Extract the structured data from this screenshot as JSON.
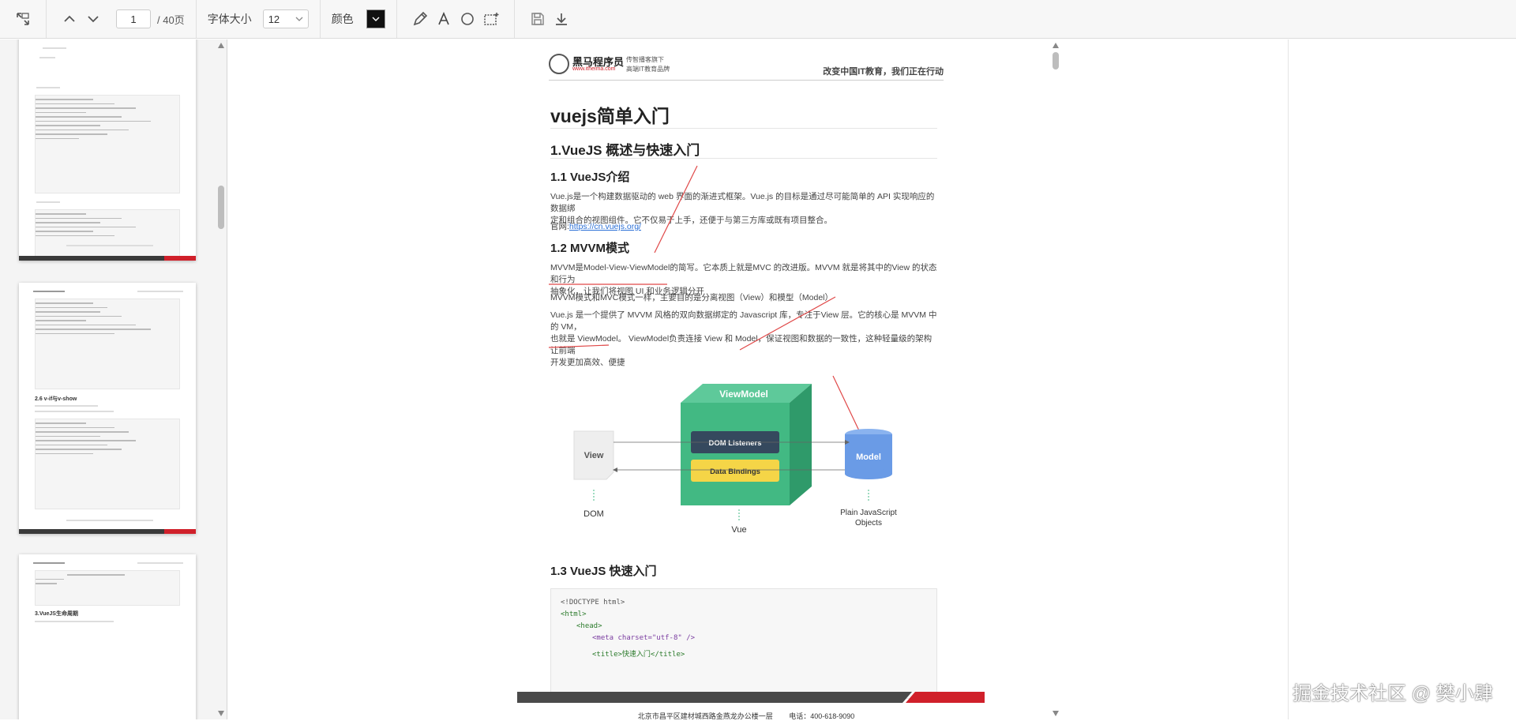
{
  "toolbar": {
    "page_current": "1",
    "page_total": "/ 40页",
    "font_size_label": "字体大小",
    "font_size_value": "12",
    "color_label": "颜色",
    "colors": {
      "swatch": "#111111"
    },
    "icons": [
      "fit-width-icon",
      "prev-page-icon",
      "next-page-icon",
      "pencil-icon",
      "text-icon",
      "circle-icon",
      "rectangle-select-icon",
      "save-icon",
      "download-icon"
    ]
  },
  "document": {
    "header": {
      "logo_name": "黑马程序员",
      "logo_url": "www.itheima.com",
      "logo_sub1": "传智播客旗下",
      "logo_sub2": "高端IT教育品牌",
      "slogan": "改变中国IT教育，我们正在行动"
    },
    "title": "vuejs简单入门",
    "section1": "1.VueJS 概述与快速入门",
    "s11": {
      "heading": "1.1 VueJS介绍",
      "p1_line1": "Vue.js是一个构建数据驱动的 web 界面的渐进式框架。Vue.js 的目标是通过尽可能简单的 API 实现响应的数据绑",
      "p1_line2": "定和组合的视图组件。它不仅易于上手，还便于与第三方库或既有项目整合。",
      "site_label": "官网:",
      "site_url": "https://cn.vuejs.org/"
    },
    "s12": {
      "heading": "1.2 MVVM模式",
      "p1_line1": "MVVM是Model-View-ViewModel的简写。它本质上就是MVC 的改进版。MVVM 就是将其中的View 的状态和行为",
      "p1_line2": "抽象化，让我们将视图 UI 和业务逻辑分开",
      "p2": "MVVM模式和MVC模式一样，主要目的是分离视图（View）和模型（Model）",
      "p3_line1": "Vue.js 是一个提供了 MVVM 风格的双向数据绑定的 Javascript 库，专注于View 层。它的核心是 MVVM 中的 VM，",
      "p3_line2": "也就是 ViewModel。 ViewModel负责连接 View 和 Model，保证视图和数据的一致性，这种轻量级的架构让前端",
      "p3_line3": "开发更加高效、便捷"
    },
    "diagram": {
      "viewmodel": "ViewModel",
      "dom_listeners": "DOM Listeners",
      "data_bindings": "Data Bindings",
      "view": "View",
      "model": "Model",
      "dom": "DOM",
      "vue": "Vue",
      "plain_js_line1": "Plain JavaScript",
      "plain_js_line2": "Objects",
      "colors": {
        "cube_front": "#42b983",
        "cube_top": "#5ec99a",
        "cube_side": "#2f9a6a",
        "listeners": "#35495e",
        "bindings": "#f5d547",
        "model": "#6a9be6"
      }
    },
    "s13": {
      "heading": "1.3 VueJS 快速入门",
      "code": [
        "<!DOCTYPE html>",
        "<html>",
        "<head>",
        "<meta charset=\"utf-8\" />",
        "<title>快速入门</title>"
      ]
    },
    "footer": {
      "address": "北京市昌平区建材城西路金燕龙办公楼一层",
      "phone": "电话：400-618-9090"
    }
  },
  "sidebar": {
    "thumb2_heading": "2.6 v-if与v-show",
    "thumb3_heading": "3.VueJS生命周期"
  },
  "watermark": "掘金技术社区 @ 樊小肆"
}
